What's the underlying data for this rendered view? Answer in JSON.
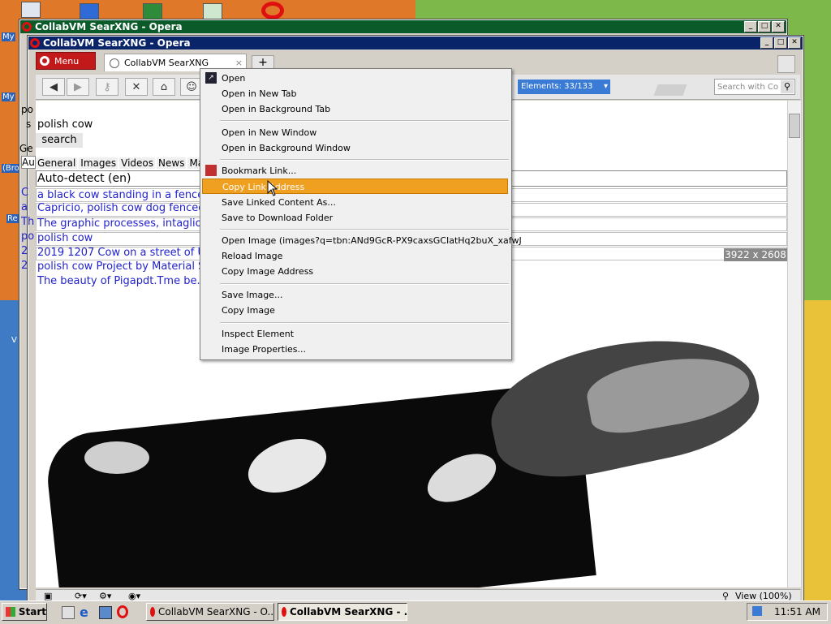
{
  "desktop": {
    "labels": [
      "My",
      "My",
      "(Bro",
      "Re",
      "V"
    ]
  },
  "back_window": {
    "title": "CollabVM SearXNG - Opera"
  },
  "front_window": {
    "title": "CollabVM SearXNG - Opera"
  },
  "browser": {
    "menu_label": "Menu",
    "tab_title": "CollabVM SearXNG",
    "tab_close": "×",
    "new_tab": "+",
    "elements_label": "Elements:  33/133",
    "search_placeholder": "Search with Co",
    "status_zoom": "View (100%)"
  },
  "page": {
    "query": "polish cow",
    "search_button": "search",
    "left_fragments": [
      "po",
      "s",
      "Ge",
      "Au",
      "C",
      "a",
      "2",
      "Th",
      "po",
      "2",
      "po",
      "Th"
    ],
    "category_tabs": [
      "General",
      "Images",
      "Videos",
      "News",
      "Map"
    ],
    "language_select": "Auto-detect (en)",
    "result_lines": [
      "a black cow standing in a fenced",
      "Capricio, polish cow dog fenced",
      "The graphic processes, intaglio",
      "polish cow",
      "2019 1207 Cow on a street of Uc",
      "polish cow Project by Material Su",
      "The beauty of Pigapdt.Tme be..."
    ],
    "image_dims": "3922 x 2608"
  },
  "context_menu": {
    "items": [
      "Open",
      "Open in New Tab",
      "Open in Background Tab",
      "Open in New Window",
      "Open in Background Window",
      "Bookmark Link...",
      "Copy Link Address",
      "Save Linked Content As...",
      "Save to Download Folder",
      "Open Image (images?q=tbn:ANd9GcR-PX9caxsGCIatHq2buX_xafwJ",
      "Reload Image",
      "Copy Image Address",
      "Save Image...",
      "Copy Image",
      "Inspect Element",
      "Image Properties..."
    ],
    "highlighted": "Copy Link Address"
  },
  "taskbar": {
    "start_label": "Start",
    "task1": "CollabVM SearXNG - O...",
    "task2": "CollabVM SearXNG - ...",
    "clock": "11:51 AM"
  },
  "colors": {
    "titlebar_active": "#0a246a",
    "titlebar_inactive": "#0a5a2a",
    "menu_highlight": "#f0a020",
    "opera_red": "#e01010",
    "elements_blue": "#3a7bd5"
  }
}
